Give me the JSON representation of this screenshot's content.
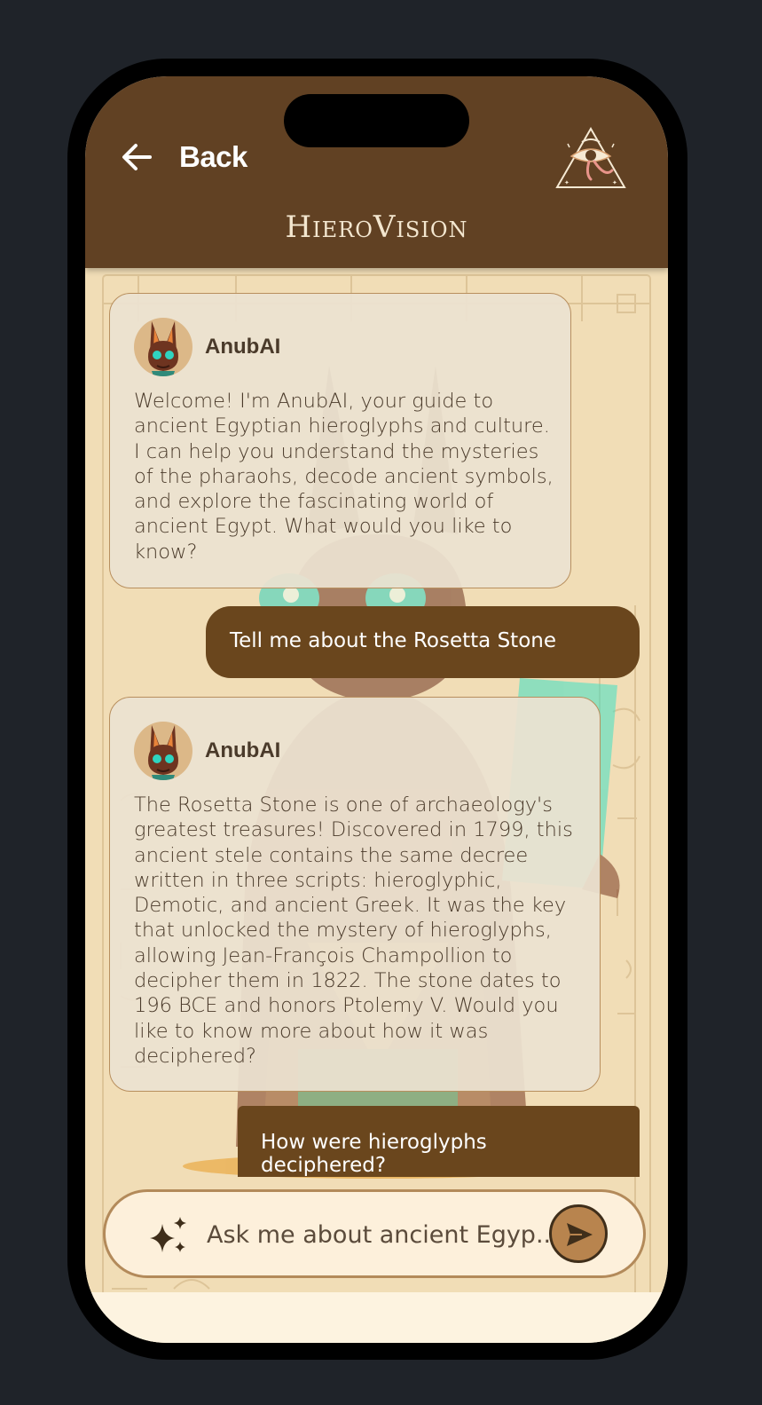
{
  "header": {
    "back_label": "Back",
    "app_title": "HieroVision"
  },
  "colors": {
    "header_bg": "#614123",
    "accent": "#b8844e",
    "user_bubble": "#6a461d",
    "papyrus": "#f1ddb6"
  },
  "messages": [
    {
      "role": "assistant",
      "author": "AnubAI",
      "text": "Welcome! I'm AnubAI, your guide to ancient Egyptian hieroglyphs and culture. I can help you understand the mysteries of the pharaohs, decode ancient symbols, and explore the fascinating world of ancient Egypt. What would you like to know?"
    },
    {
      "role": "user",
      "text": "Tell me about the Rosetta Stone"
    },
    {
      "role": "assistant",
      "author": "AnubAI",
      "text": "The Rosetta Stone is one of archaeology's greatest treasures! Discovered in 1799, this ancient stele contains the same decree written in three scripts: hieroglyphic, Demotic, and ancient Greek. It was the key that unlocked the mystery of hieroglyphs, allowing Jean-François Champollion to decipher them in 1822. The stone dates to 196 BCE and honors Ptolemy V. Would you like to know more about how it was deciphered?"
    },
    {
      "role": "user",
      "text": "How were hieroglyphs deciphered?"
    }
  ],
  "input": {
    "placeholder": "Ask me about ancient Egyp..."
  },
  "icons": {
    "back": "arrow-left-icon",
    "logo": "eye-of-ra-pyramid-logo",
    "input": "sparkle-icon",
    "send": "send-icon"
  }
}
